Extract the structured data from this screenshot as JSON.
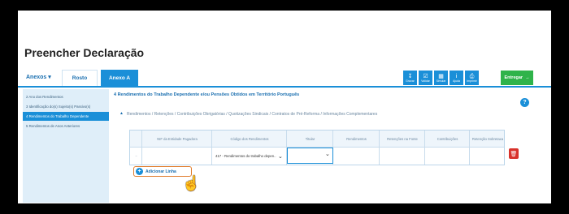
{
  "page": {
    "title": "Preencher Declaração"
  },
  "tabs": {
    "annex_dropdown": "Anexos",
    "rosto": "Rosto",
    "anexo_a": "Anexo A"
  },
  "toolbar": {
    "buttons": [
      {
        "label": "Gravar",
        "icon": "download-icon"
      },
      {
        "label": "Validar",
        "icon": "check-external-icon"
      },
      {
        "label": "Simular",
        "icon": "calculator-icon"
      },
      {
        "label": "Ajuda",
        "icon": "info-icon"
      },
      {
        "label": "Imprimir",
        "icon": "print-icon"
      }
    ],
    "submit": "Entregar"
  },
  "sidebar": {
    "items": [
      {
        "label": "2  Ano dos Rendimentos"
      },
      {
        "label": "3  Identificação do(s) Sujeito(s) Passivo(s)"
      },
      {
        "label": "4  Rendimentos do Trabalho Dependente"
      },
      {
        "label": "5  Rendimentos de Anos Anteriores"
      }
    ]
  },
  "section": {
    "title": "4  Rendimentos do Trabalho Dependente e/ou Pensões Obtidos em Território Português",
    "breadcrumb": "Rendimentos / Retenções / Contribuições Obrigatórias / Quotizações Sindicais / Contratos de Pré-Reforma / Informações Complementares"
  },
  "table": {
    "headers": [
      "NIF da Entidade Pagadora",
      "Código dos Rendimentos",
      "Titular",
      "Rendimentos",
      "Retenções na Fonte",
      "Contribuições",
      "Retenção Sobretaxa"
    ],
    "row": {
      "code": "417 - Rendimentos do trabalho depen..",
      "titular": ""
    }
  },
  "actions": {
    "add_line": "Adicionar Linha"
  }
}
